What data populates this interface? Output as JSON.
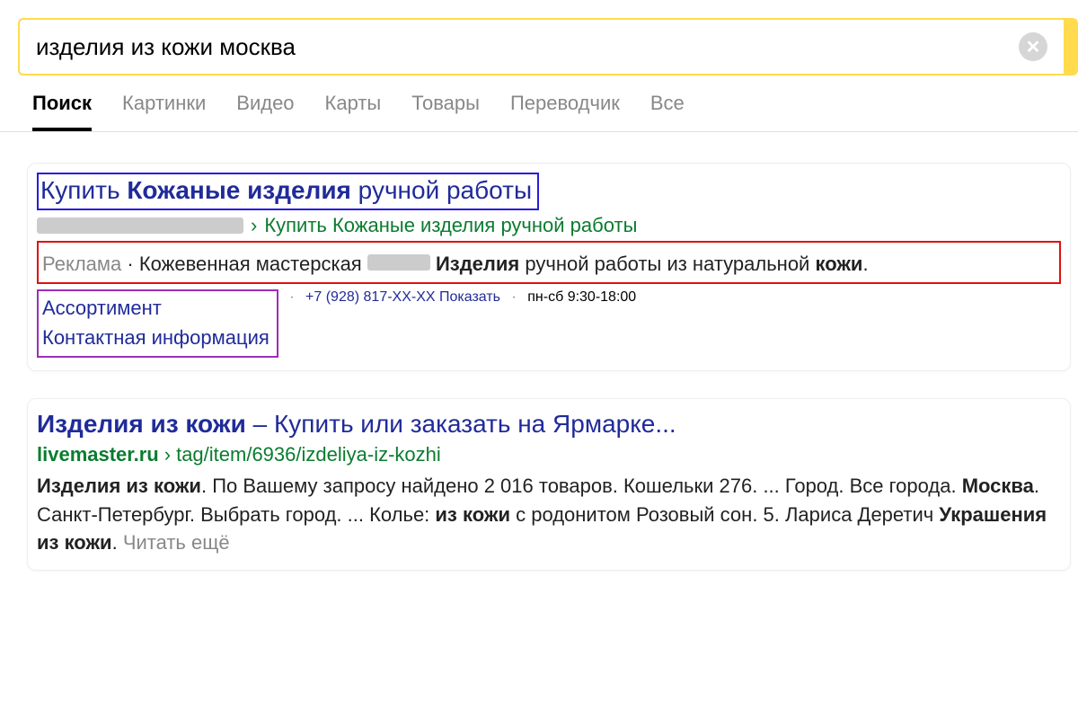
{
  "search": {
    "query": "изделия из кожи москва"
  },
  "tabs": [
    {
      "label": "Поиск",
      "active": true
    },
    {
      "label": "Картинки"
    },
    {
      "label": "Видео"
    },
    {
      "label": "Карты"
    },
    {
      "label": "Товары"
    },
    {
      "label": "Переводчик"
    },
    {
      "label": "Все"
    }
  ],
  "ad": {
    "title_prefix": "Купить ",
    "title_bold": "Кожаные изделия",
    "title_suffix": " ручной работы",
    "breadcrumb_sep": "›",
    "breadcrumb_text": "Купить Кожаные изделия ручной работы",
    "ad_label": "Реклама",
    "dot": " · ",
    "snippet_prefix": "Кожевенная мастерская ",
    "snippet_bold1": "Изделия",
    "snippet_mid": " ручной работы из натуральной ",
    "snippet_bold2": "кожи",
    "snippet_end": ".",
    "sitelink1": "Ассортимент",
    "sitelink2": "Контактная информация",
    "phone": "+7 (928) 817-XX-XX ",
    "phone_action": "Показать",
    "hours": "пн-сб 9:30-18:00"
  },
  "r1": {
    "title_bold": "Изделия из кожи",
    "title_dash": " – ",
    "title_rest": "Купить или заказать на Ярмарке...",
    "url_domain": "livemaster.ru",
    "url_sep": "›",
    "url_path": "tag/item/6936/izdeliya-iz-kozhi",
    "s_b1": "Изделия из кожи",
    "s_t1": ". По Вашему запросу найдено 2 016 товаров. Кошельки 276. ... Город. Все города. ",
    "s_b2": "Москва",
    "s_t2": ". Санкт-Петербург. Выбрать город. ... Колье: ",
    "s_b3": "из кожи",
    "s_t3": " с родонитом Розовый сон. 5. Лариса Деретич ",
    "s_b4": "Украшения из кожи",
    "s_t4": ". ",
    "readmore": "Читать ещё"
  }
}
